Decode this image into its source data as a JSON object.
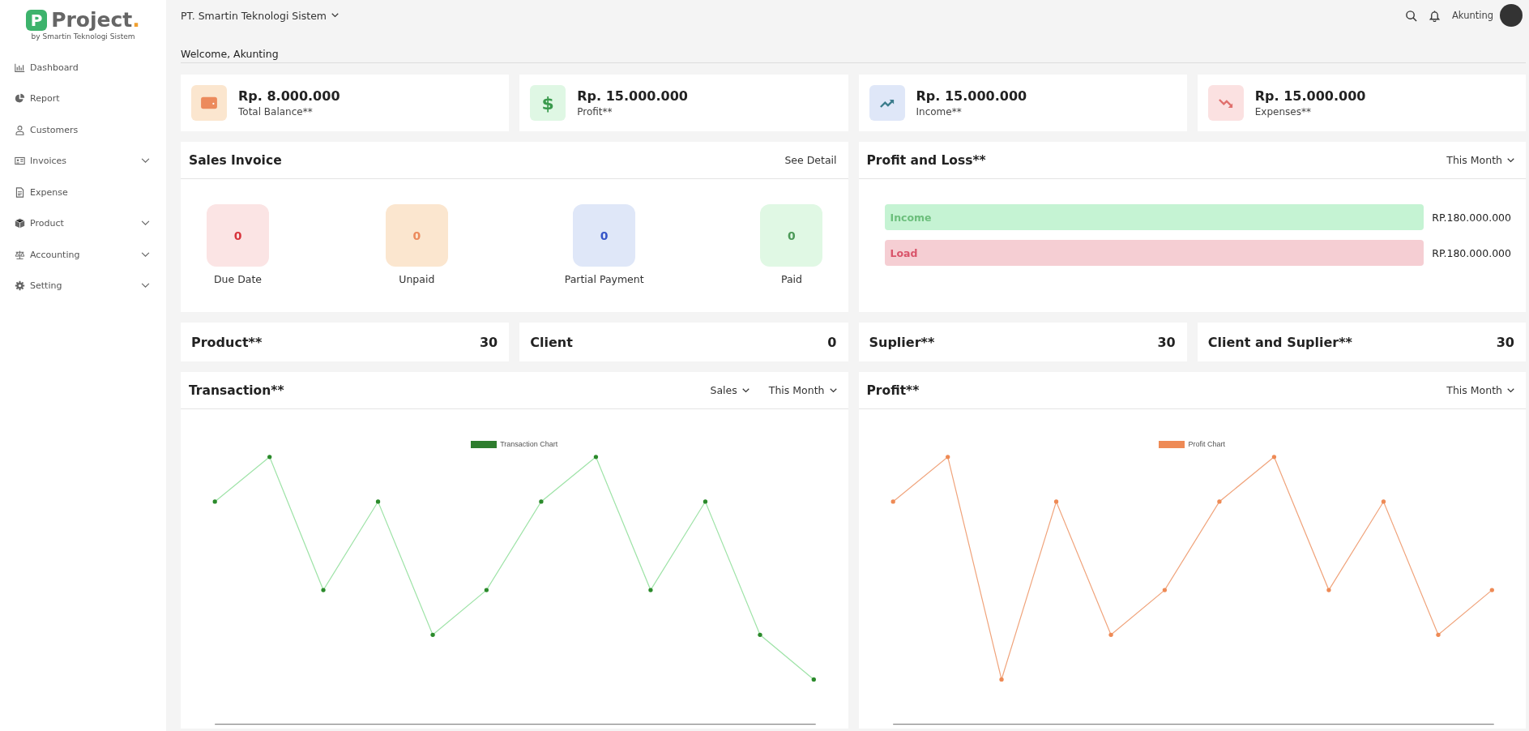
{
  "sidebar": {
    "logo": {
      "letter": "P",
      "name": "Project",
      "dot": ".",
      "tagline": "by Smartin Teknologi Sistem"
    },
    "items": [
      {
        "label": "Dashboard",
        "has_submenu": false
      },
      {
        "label": "Report",
        "has_submenu": false
      },
      {
        "label": "Customers",
        "has_submenu": false
      },
      {
        "label": "Invoices",
        "has_submenu": true
      },
      {
        "label": "Expense",
        "has_submenu": false
      },
      {
        "label": "Product",
        "has_submenu": true
      },
      {
        "label": "Accounting",
        "has_submenu": true
      },
      {
        "label": "Setting",
        "has_submenu": true
      }
    ]
  },
  "topbar": {
    "company": "PT. Smartin Teknologi Sistem",
    "user": "Akunting"
  },
  "welcome": "Welcome, Akunting",
  "stats": [
    {
      "kind": "balance",
      "value": "Rp. 8.000.000",
      "label": "Total Balance**"
    },
    {
      "kind": "profit",
      "symbol": "$",
      "value": "Rp. 15.000.000",
      "label": "Profit**"
    },
    {
      "kind": "income",
      "value": "Rp. 15.000.000",
      "label": "Income**"
    },
    {
      "kind": "expense",
      "value": "Rp. 15.000.000",
      "label": "Expenses**"
    }
  ],
  "sales_invoice": {
    "title": "Sales Invoice",
    "link": "See Detail",
    "statuses": [
      {
        "kind": "due",
        "count": "0",
        "label": "Due Date"
      },
      {
        "kind": "unpaid",
        "count": "0",
        "label": "Unpaid"
      },
      {
        "kind": "partial",
        "count": "0",
        "label": "Partial Payment"
      },
      {
        "kind": "paid",
        "count": "0",
        "label": "Paid"
      }
    ]
  },
  "profit_loss": {
    "title": "Profit and Loss**",
    "period": "This Month",
    "rows": [
      {
        "kind": "income",
        "label": "Income",
        "amount": "RP.180.000.000"
      },
      {
        "kind": "load",
        "label": "Load",
        "amount": "RP.180.000.000"
      }
    ]
  },
  "counts": [
    {
      "label": "Product**",
      "value": "30"
    },
    {
      "label": "Client",
      "value": "0"
    },
    {
      "label": "Suplier**",
      "value": "30"
    },
    {
      "label": "Client and Suplier**",
      "value": "30"
    }
  ],
  "charts": [
    {
      "kind": "transaction",
      "title": "Transaction**",
      "filters": [
        "Sales",
        "This Month"
      ],
      "legend": "Transaction Chart"
    },
    {
      "kind": "profit",
      "title": "Profit**",
      "filters": [
        "This Month"
      ],
      "legend": "Profit Chart"
    }
  ]
}
